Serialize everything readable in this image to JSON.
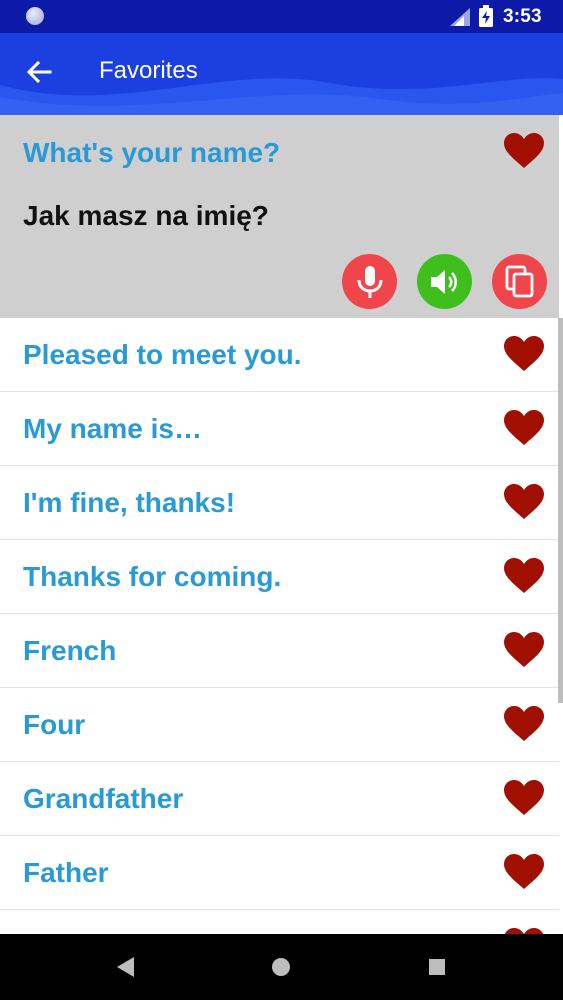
{
  "status_bar": {
    "time": "3:53"
  },
  "app_bar": {
    "title": "Favorites"
  },
  "expanded_item": {
    "phrase": "What's your name?",
    "translation": "Jak masz na imię?"
  },
  "items": [
    {
      "phrase": "Pleased to meet you."
    },
    {
      "phrase": "My name is…"
    },
    {
      "phrase": "I'm fine, thanks!"
    },
    {
      "phrase": "Thanks for coming."
    },
    {
      "phrase": "French"
    },
    {
      "phrase": "Four"
    },
    {
      "phrase": "Grandfather"
    },
    {
      "phrase": "Father"
    }
  ],
  "colors": {
    "status_bar": "#0d1aa8",
    "app_bar": "#1c3fe0",
    "phrase": "#2a9ad6",
    "translation": "#111111",
    "heart": "#a10f00",
    "mic_button": "#f0454b",
    "speaker_button": "#3fbf1e",
    "copy_button": "#f0454b",
    "expanded_background": "#cfcfcf"
  },
  "icons": {
    "back": "arrow-left-icon",
    "favorite": "heart-icon",
    "mic": "microphone-icon",
    "speaker": "speaker-icon",
    "copy": "copy-icon"
  }
}
